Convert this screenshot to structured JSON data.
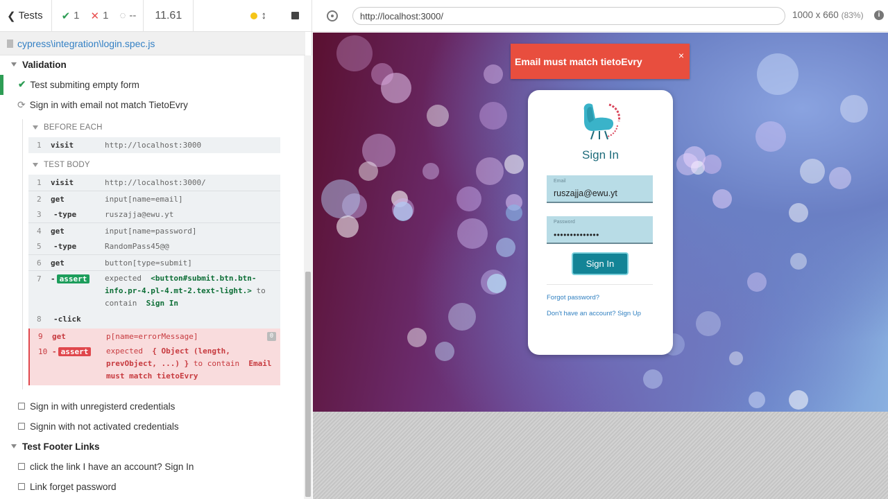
{
  "reporter": {
    "back_label": "Tests",
    "stats": {
      "passed": "1",
      "failed": "1",
      "pending": "--"
    },
    "duration": "11.61",
    "spec_path": "cypress\\integration\\login.spec.js"
  },
  "tree": {
    "suite_validation": "Validation",
    "test_empty_form": "Test submiting empty form",
    "test_email_match": "Sign in with email not match TietoEvry",
    "before_each_label": "BEFORE EACH",
    "before_each_cmds": [
      {
        "n": "1",
        "name": "visit",
        "msg": "http://localhost:3000"
      }
    ],
    "test_body_label": "TEST BODY",
    "body_cmds": [
      {
        "n": "1",
        "name": "visit",
        "msg": "http://localhost:3000/"
      },
      {
        "n": "2",
        "name": "get",
        "msg": "input[name=email]"
      },
      {
        "n": "3",
        "name": "-type",
        "msg": "ruszajja@ewu.yt"
      },
      {
        "n": "4",
        "name": "get",
        "msg": "input[name=password]"
      },
      {
        "n": "5",
        "name": "-type",
        "msg": "RandomPass45@@"
      },
      {
        "n": "6",
        "name": "get",
        "msg": "button[type=submit]"
      }
    ],
    "assert1": {
      "n": "7",
      "dash": "-",
      "badge": "assert",
      "expected": "expected",
      "selector_l1": "<button#submit.btn.btn-",
      "selector_l2": "info.pr-4.pl-4.mt-2.text-light.>",
      "to": "to",
      "contain": "contain",
      "value": "Sign In"
    },
    "click_cmd": {
      "n": "8",
      "name": "-click"
    },
    "err_get": {
      "n": "9",
      "name": "get",
      "msg": "p[name=errorMessage]",
      "badge": "0"
    },
    "err_assert": {
      "n": "10",
      "dash": "-",
      "badge": "assert",
      "expected": "expected",
      "obj_l1": "{ Object (length,",
      "obj_l2": "prevObject, ...) }",
      "to_contain": "to contain",
      "value_l1": "Email",
      "value_l2": "must match tietoEvry"
    },
    "test_unregistered": "Sign in with unregisterd credentials",
    "test_not_activated": "Signin with not activated credentials",
    "suite_footer": "Test Footer Links",
    "test_have_account": "click the link I have an account? Sign In",
    "test_forget_pw": "Link forget password"
  },
  "browser": {
    "url": "http://localhost:3000/",
    "viewport": "1000 x 660",
    "zoom": "(83%)"
  },
  "app": {
    "toast": "Email must match tietoEvry",
    "toast_close": "×",
    "title": "Sign In",
    "email_label": "Email",
    "email_value": "ruszajja@ewu.yt",
    "password_label": "Password",
    "password_value": "••••••••••••••",
    "signin_button": "Sign In",
    "forgot_link": "Forgot password?",
    "signup_link": "Don't have an account? Sign Up"
  },
  "colors": {
    "pass": "#2e9d55",
    "fail": "#e94f4f",
    "toast": "#e84e3e",
    "button": "#138496",
    "link": "#3380c4"
  }
}
